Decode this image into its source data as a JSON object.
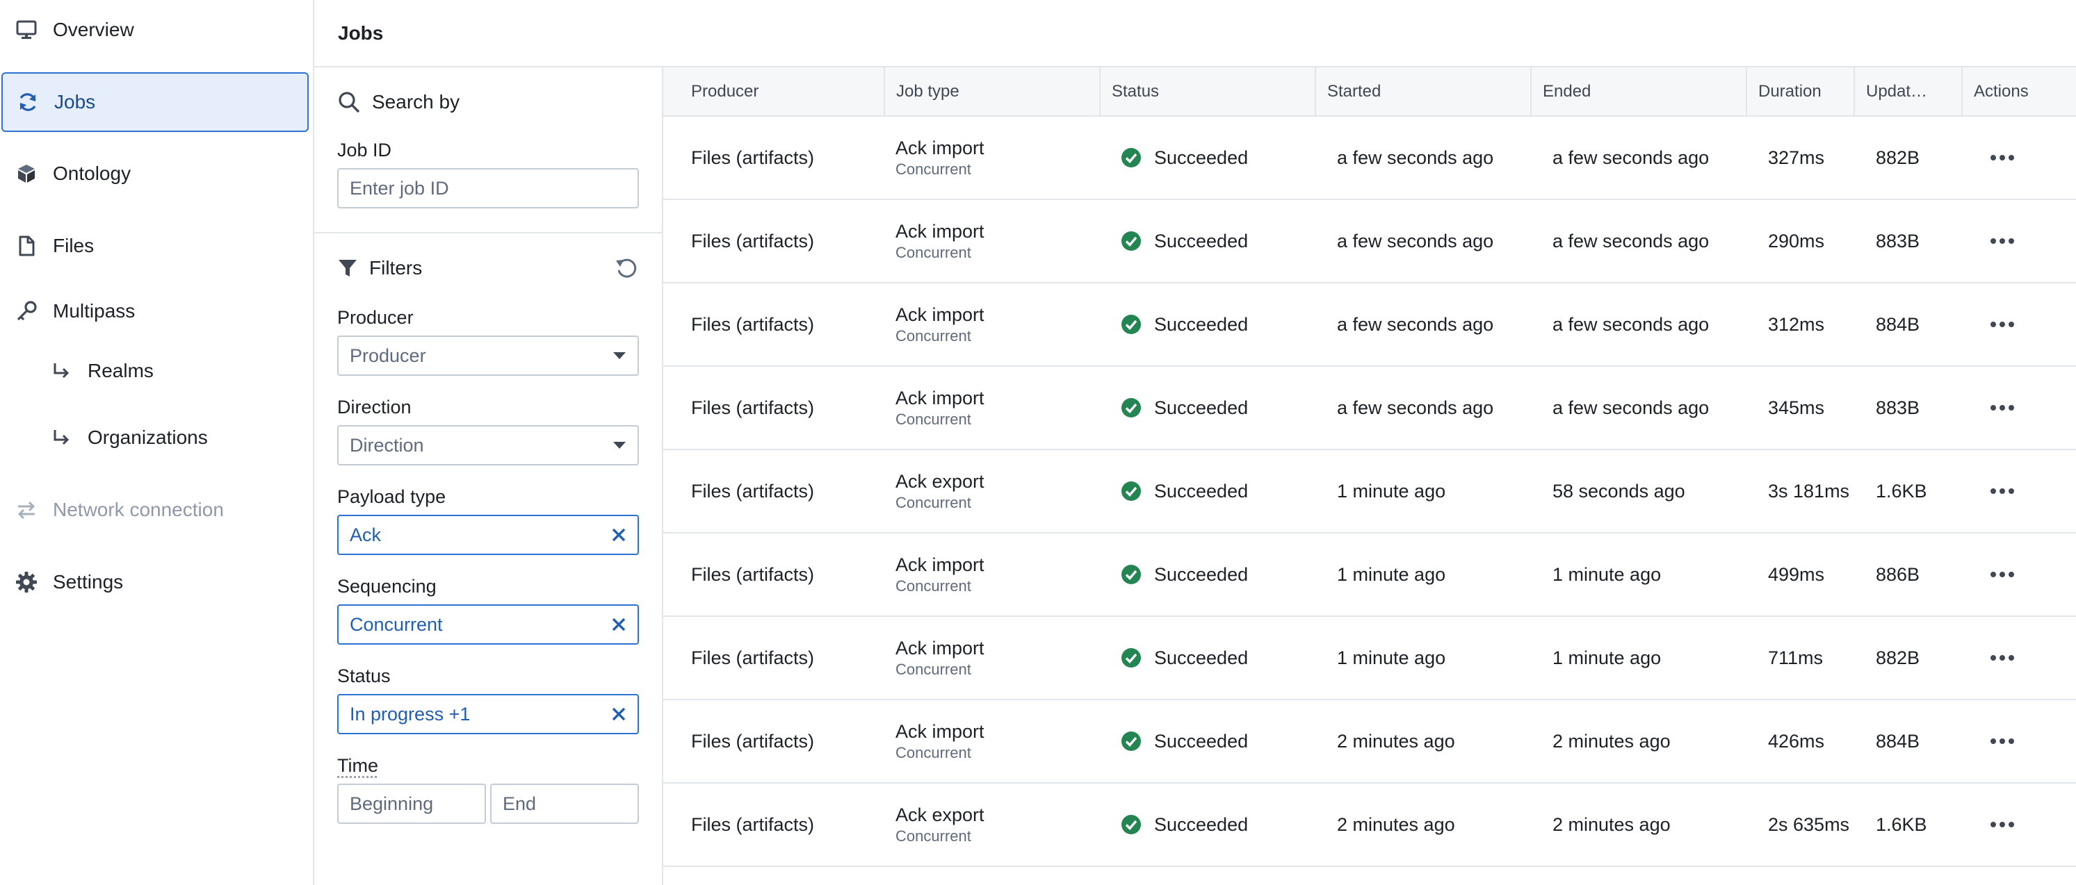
{
  "nav": {
    "items": [
      {
        "label": "Overview",
        "icon": "desktop-icon",
        "state": "normal"
      },
      {
        "label": "Jobs",
        "icon": "refresh-icon",
        "state": "active"
      },
      {
        "label": "Ontology",
        "icon": "cube-icon",
        "state": "normal"
      },
      {
        "label": "Files",
        "icon": "document-icon",
        "state": "normal"
      },
      {
        "label": "Multipass",
        "icon": "key-icon",
        "state": "normal"
      },
      {
        "label": "Realms",
        "icon": "arrow-return-icon",
        "state": "sub"
      },
      {
        "label": "Organizations",
        "icon": "arrow-return-icon",
        "state": "sub"
      },
      {
        "label": "Network connection",
        "icon": "swap-arrows-icon",
        "state": "disabled"
      },
      {
        "label": "Settings",
        "icon": "gear-icon",
        "state": "normal"
      }
    ]
  },
  "page": {
    "title": "Jobs"
  },
  "search": {
    "heading": "Search by",
    "job_id_label": "Job ID",
    "job_id_placeholder": "Enter job ID"
  },
  "filters": {
    "heading": "Filters",
    "producer_label": "Producer",
    "producer_value": "Producer",
    "direction_label": "Direction",
    "direction_value": "Direction",
    "payload_label": "Payload type",
    "payload_value": "Ack",
    "sequencing_label": "Sequencing",
    "sequencing_value": "Concurrent",
    "status_label": "Status",
    "status_value": "In progress +1",
    "time_label": "Time",
    "time_begin_placeholder": "Beginning",
    "time_end_placeholder": "End"
  },
  "table": {
    "columns": [
      "Producer",
      "Job type",
      "Status",
      "Started",
      "Ended",
      "Duration",
      "Updat…",
      "Actions"
    ],
    "rows": [
      {
        "producer": "Files (artifacts)",
        "job_type": "Ack import",
        "sequencing": "Concurrent",
        "status": "Succeeded",
        "started": "a few seconds ago",
        "ended": "a few seconds ago",
        "duration": "327ms",
        "size": "882B"
      },
      {
        "producer": "Files (artifacts)",
        "job_type": "Ack import",
        "sequencing": "Concurrent",
        "status": "Succeeded",
        "started": "a few seconds ago",
        "ended": "a few seconds ago",
        "duration": "290ms",
        "size": "883B"
      },
      {
        "producer": "Files (artifacts)",
        "job_type": "Ack import",
        "sequencing": "Concurrent",
        "status": "Succeeded",
        "started": "a few seconds ago",
        "ended": "a few seconds ago",
        "duration": "312ms",
        "size": "884B"
      },
      {
        "producer": "Files (artifacts)",
        "job_type": "Ack import",
        "sequencing": "Concurrent",
        "status": "Succeeded",
        "started": "a few seconds ago",
        "ended": "a few seconds ago",
        "duration": "345ms",
        "size": "883B"
      },
      {
        "producer": "Files (artifacts)",
        "job_type": "Ack export",
        "sequencing": "Concurrent",
        "status": "Succeeded",
        "started": "1 minute ago",
        "ended": "58 seconds ago",
        "duration": "3s 181ms",
        "size": "1.6KB"
      },
      {
        "producer": "Files (artifacts)",
        "job_type": "Ack import",
        "sequencing": "Concurrent",
        "status": "Succeeded",
        "started": "1 minute ago",
        "ended": "1 minute ago",
        "duration": "499ms",
        "size": "886B"
      },
      {
        "producer": "Files (artifacts)",
        "job_type": "Ack import",
        "sequencing": "Concurrent",
        "status": "Succeeded",
        "started": "1 minute ago",
        "ended": "1 minute ago",
        "duration": "711ms",
        "size": "882B"
      },
      {
        "producer": "Files (artifacts)",
        "job_type": "Ack import",
        "sequencing": "Concurrent",
        "status": "Succeeded",
        "started": "2 minutes ago",
        "ended": "2 minutes ago",
        "duration": "426ms",
        "size": "884B"
      },
      {
        "producer": "Files (artifacts)",
        "job_type": "Ack export",
        "sequencing": "Concurrent",
        "status": "Succeeded",
        "started": "2 minutes ago",
        "ended": "2 minutes ago",
        "duration": "2s 635ms",
        "size": "1.6KB"
      }
    ]
  },
  "colors": {
    "accent": "#2d72d2",
    "active_bg": "#e6eefb",
    "success": "#238551",
    "border": "#e3e6e9"
  }
}
